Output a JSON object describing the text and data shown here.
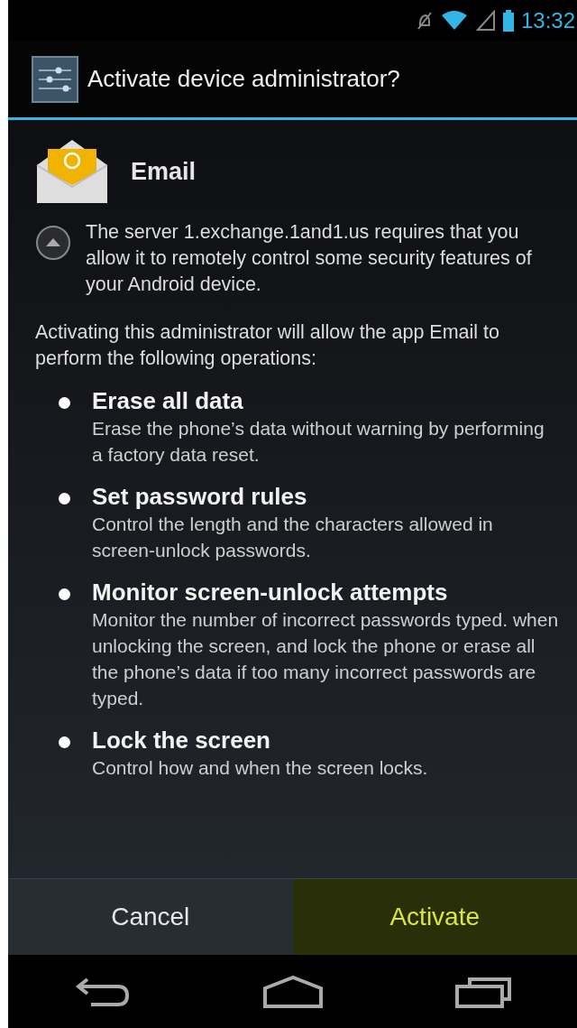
{
  "status_bar": {
    "time": "13:32"
  },
  "dialog": {
    "title": "Activate device administrator?",
    "app_name": "Email",
    "server_message": "The server 1.exchange.1and1.us requires that you allow it to remotely control some security features of your Android device.",
    "intro": "Activating this administrator will allow the app Email to perform the following operations:",
    "policies": [
      {
        "title": "Erase all data",
        "description": "Erase the phone’s data without warning by performing a factory data reset."
      },
      {
        "title": "Set password rules",
        "description": "Control the length and the characters allowed in screen-unlock passwords."
      },
      {
        "title": "Monitor screen-unlock attempts",
        "description": "Monitor the number of incorrect passwords typed. when unlocking the screen, and lock the phone or erase all the phone’s data if too many incorrect passwords are typed."
      },
      {
        "title": "Lock the screen",
        "description": "Control how and when the screen locks."
      }
    ],
    "buttons": [
      {
        "label": "Cancel",
        "kind": "neutral"
      },
      {
        "label": "Activate",
        "kind": "positive"
      }
    ]
  }
}
